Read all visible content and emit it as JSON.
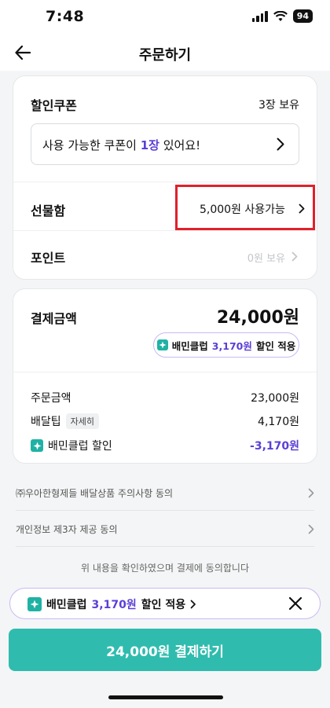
{
  "status_bar": {
    "time": "7:48",
    "battery": "94"
  },
  "header": {
    "title": "주문하기"
  },
  "coupon": {
    "label": "할인쿠폰",
    "count": "3장 보유",
    "message_prefix": "사용 가능한 쿠폰이 ",
    "message_count": "1장",
    "message_suffix": " 있어요!"
  },
  "gift": {
    "label": "선물함",
    "value": "5,000원 사용가능"
  },
  "point": {
    "label": "포인트",
    "value": "0원 보유"
  },
  "payment": {
    "label": "결제금액",
    "total": "24,000원",
    "club_pill": {
      "name": "배민클럽",
      "price": "3,170원",
      "action": "할인 적용"
    },
    "rows": [
      {
        "label": "주문금액",
        "value": "23,000원"
      },
      {
        "label": "배달팁",
        "tag": "자세히",
        "value": "4,170원"
      },
      {
        "label": "배민클럽 할인",
        "value": "-3,170원"
      }
    ]
  },
  "agreements": [
    {
      "label": "㈜우아한형제들 배달상품 주의사항 동의"
    },
    {
      "label": "개인정보 제3자 제공 동의"
    }
  ],
  "confirm_text": "위 내용을 확인하였으며 결제에 동의합니다",
  "club_banner": {
    "name": "배민클럽",
    "price": "3,170원",
    "action": "할인 적용"
  },
  "pay_button": {
    "label": "24,000원 결제하기"
  },
  "colors": {
    "accent": "#2fbcae",
    "purple": "#5b3fd6",
    "highlight": "#e0202b"
  }
}
